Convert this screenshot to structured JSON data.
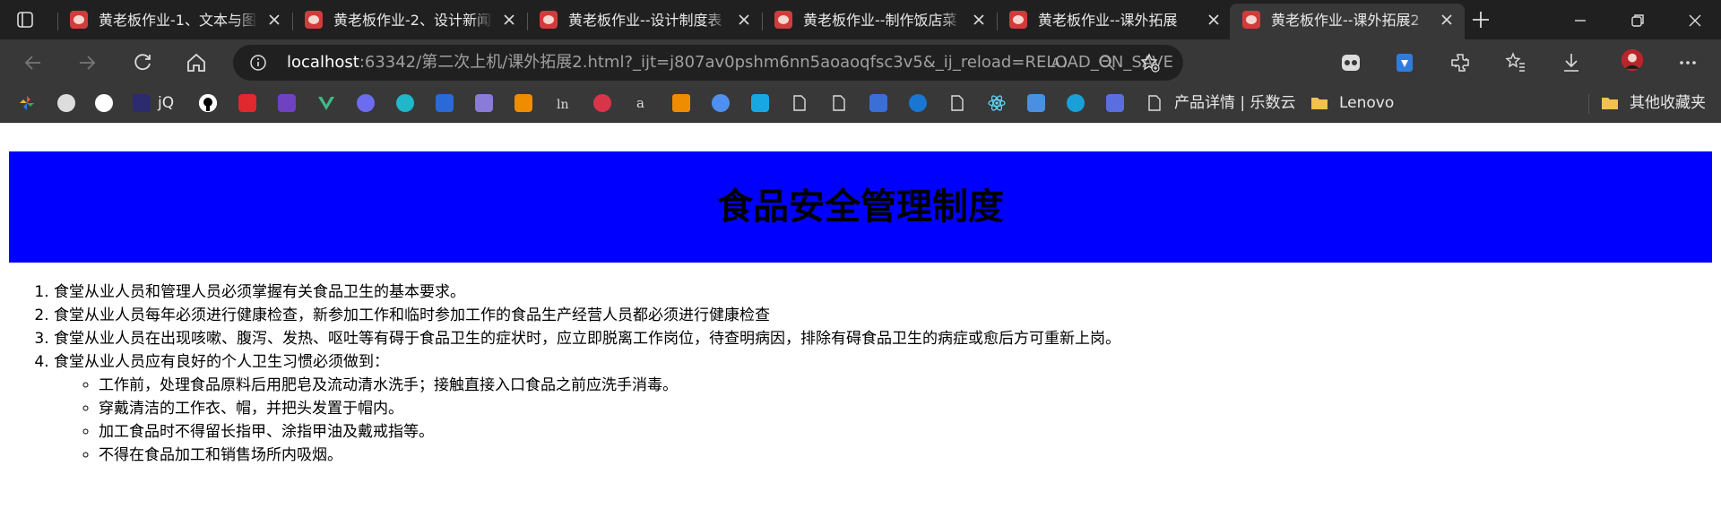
{
  "tabs": [
    {
      "title": "黄老板作业-1、文本与图",
      "active": false
    },
    {
      "title": "黄老板作业-2、设计新闻",
      "active": false
    },
    {
      "title": "黄老板作业--设计制度表",
      "active": false
    },
    {
      "title": "黄老板作业--制作饭店菜",
      "active": false
    },
    {
      "title": "黄老板作业--课外拓展",
      "active": false
    },
    {
      "title": "黄老板作业--课外拓展2",
      "active": true
    }
  ],
  "address": {
    "host": "localhost",
    "path": ":63342/第二次上机/课外拓展2.html?_ijt=j807av0pshm6nn5aoaoqfsc3v5&_ij_reload=RELOAD_ON_SAVE"
  },
  "bookmarks": {
    "jq_label": "jQ",
    "product_label": "产品详情 | 乐数云",
    "lenovo_label": "Lenovo",
    "other_label": "其他收藏夹"
  },
  "page": {
    "title": "食品安全管理制度",
    "items": [
      "食堂从业人员和管理人员必须掌握有关食品卫生的基本要求。",
      "食堂从业人员每年必须进行健康检查，新参加工作和临时参加工作的食品生产经营人员都必须进行健康检查",
      "食堂从业人员在出现咳嗽、腹泻、发热、呕吐等有碍于食品卫生的症状时，应立即脱离工作岗位，待查明病因，排除有碍食品卫生的病症或愈后方可重新上岗。",
      "食堂从业人员应有良好的个人卫生习惯必须做到："
    ],
    "subitems": [
      "工作前，处理食品原料后用肥皂及流动清水洗手；接触直接入口食品之前应洗手消毒。",
      "穿戴清洁的工作衣、帽，并把头发置于帽内。",
      "加工食品时不得留长指甲、涂指甲油及戴戒指等。",
      "不得在食品加工和销售场所内吸烟。"
    ]
  },
  "colors": {
    "hero_background": "#0000ff",
    "tabbar": "#202020",
    "toolbar": "#383838"
  }
}
